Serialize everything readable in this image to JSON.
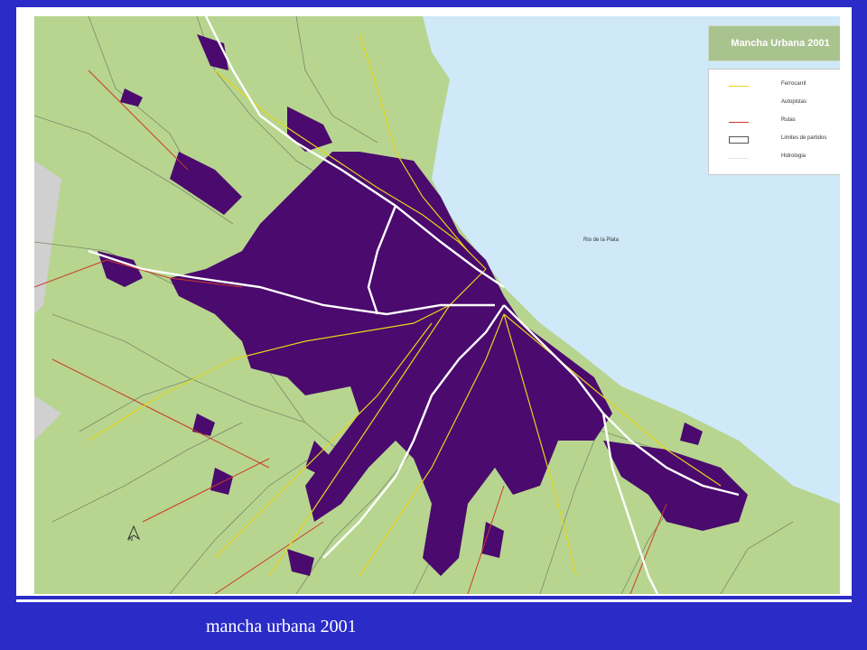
{
  "map": {
    "title": "Mancha Urbana 2001",
    "water_label": "Rio de la Plata",
    "north_label": "N",
    "legend": [
      {
        "label": "Ferrocarril",
        "color": "#e8d41a",
        "swatch": "line"
      },
      {
        "label": "Autopistas",
        "color": "#ffffff",
        "swatch": "line"
      },
      {
        "label": "Rutas",
        "color": "#cc3a2a",
        "swatch": "line"
      },
      {
        "label": "Limites de partidos",
        "color": "#ffffff",
        "swatch": "box"
      },
      {
        "label": "Hidrologia",
        "color": "#dde8f0",
        "swatch": "line"
      }
    ],
    "colors": {
      "land": "#b7d58f",
      "water": "#cfe9f8",
      "urban": "#4a0a6e",
      "outside": "#d0d0d0",
      "boundary": "#7a8a6a"
    }
  },
  "caption": "mancha urbana 2001"
}
